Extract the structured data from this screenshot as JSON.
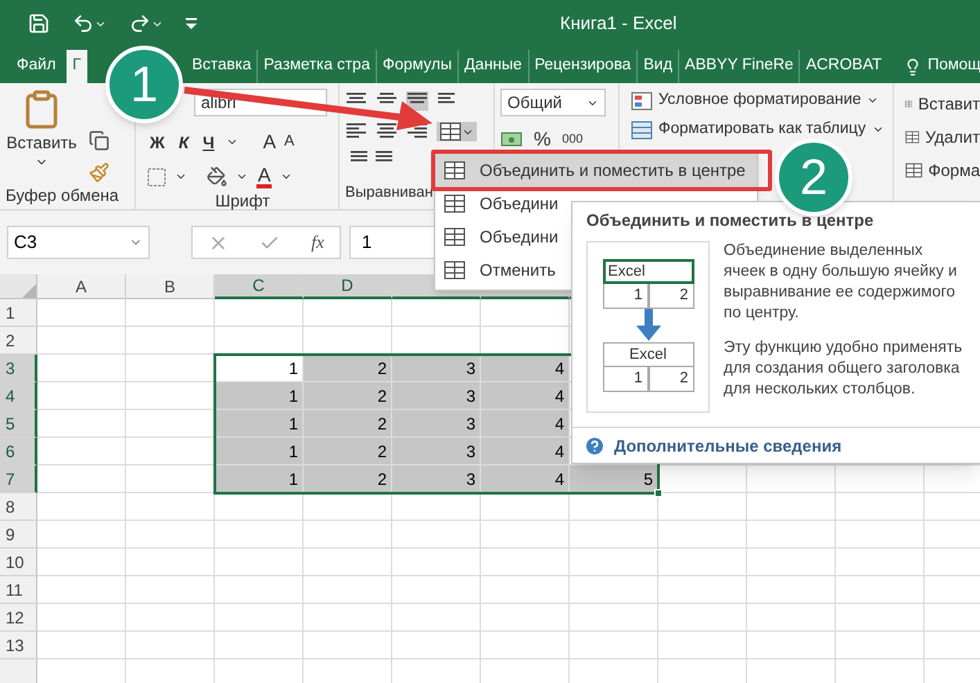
{
  "window": {
    "title": "Книга1 - Excel"
  },
  "ribbon_tabs": [
    {
      "label": "Файл",
      "selected": false
    },
    {
      "label": "Г",
      "selected": true
    },
    {
      "label": "Вставка",
      "selected": false
    },
    {
      "label": "Разметка стра",
      "selected": false
    },
    {
      "label": "Формулы",
      "selected": false
    },
    {
      "label": "Данные",
      "selected": false
    },
    {
      "label": "Рецензирова",
      "selected": false
    },
    {
      "label": "Вид",
      "selected": false
    },
    {
      "label": "ABBYY FineRe",
      "selected": false
    },
    {
      "label": "ACROBAT",
      "selected": false
    },
    {
      "label": "Помощ",
      "selected": false,
      "kind": "help"
    }
  ],
  "ribbon": {
    "clipboard": {
      "paste": "Вставить",
      "group_label": "Буфер обмена"
    },
    "font": {
      "font_name": "alibri",
      "bold": "Ж",
      "italic": "К",
      "underline": "Ч",
      "grow": "A",
      "shrink": "A",
      "font_color_button": "A",
      "group_label": "Шрифт"
    },
    "alignment": {
      "group_label": "Выравниван"
    },
    "number": {
      "format": "Общий",
      "percent": "%",
      "thousands": "000"
    },
    "styles": {
      "conditional": "Условное форматирование",
      "as_table": "Форматировать как таблицу"
    },
    "cells": {
      "insert": "Вставит",
      "delete": "Удалит",
      "format": "Форма"
    }
  },
  "formula_bar": {
    "name_box": "C3",
    "function_label": "fx",
    "value": "1"
  },
  "sheet": {
    "columns": [
      {
        "label": "A"
      },
      {
        "label": "B"
      },
      {
        "label": "C"
      },
      {
        "label": "D"
      }
    ],
    "rows": [
      {
        "label": "1",
        "cells": []
      },
      {
        "label": "2",
        "cells": []
      },
      {
        "label": "3",
        "cells": [
          {
            "value": "1",
            "selected": true,
            "active": true
          },
          {
            "value": "2",
            "selected": true,
            "active": false
          },
          {
            "value": "3",
            "selected": true,
            "active": false
          },
          {
            "value": "4",
            "selected": true,
            "active": false
          }
        ]
      },
      {
        "label": "4",
        "cells": [
          {
            "value": "1",
            "selected": true,
            "active": false
          },
          {
            "value": "2",
            "selected": true,
            "active": false
          },
          {
            "value": "3",
            "selected": true,
            "active": false
          },
          {
            "value": "4",
            "selected": true,
            "active": false
          }
        ]
      },
      {
        "label": "5",
        "cells": [
          {
            "value": "1",
            "selected": true,
            "active": false
          },
          {
            "value": "2",
            "selected": true,
            "active": false
          },
          {
            "value": "3",
            "selected": true,
            "active": false
          },
          {
            "value": "4",
            "selected": true,
            "active": false
          }
        ]
      },
      {
        "label": "6",
        "cells": [
          {
            "value": "1",
            "selected": true,
            "active": false
          },
          {
            "value": "2",
            "selected": true,
            "active": false
          },
          {
            "value": "3",
            "selected": true,
            "active": false
          },
          {
            "value": "4",
            "selected": true,
            "active": false
          }
        ]
      },
      {
        "label": "7",
        "cells": [
          {
            "value": "1",
            "selected": true,
            "active": false
          },
          {
            "value": "2",
            "selected": true,
            "active": false
          },
          {
            "value": "3",
            "selected": true,
            "active": false
          },
          {
            "value": "4",
            "selected": true,
            "active": false
          },
          {
            "value": "5",
            "selected": true,
            "active": false
          }
        ]
      },
      {
        "label": "8",
        "cells": []
      },
      {
        "label": "9",
        "cells": []
      },
      {
        "label": "10",
        "cells": []
      },
      {
        "label": "11",
        "cells": []
      },
      {
        "label": "12",
        "cells": []
      },
      {
        "label": "13",
        "cells": []
      }
    ]
  },
  "merge_menu": {
    "items": [
      {
        "label": "Объединить и поместить в центре",
        "selected": true
      },
      {
        "label": "Объедини",
        "selected": false
      },
      {
        "label": "Объедини",
        "selected": false
      },
      {
        "label": "Отменить",
        "selected": false
      }
    ]
  },
  "tooltip": {
    "title": "Объединить и поместить в центре",
    "example": {
      "before": {
        "header": "Excel",
        "cells": [
          "1",
          "2"
        ]
      },
      "after": {
        "header": "Excel",
        "cells": [
          "1",
          "2"
        ]
      }
    },
    "body": [
      "Объединение выделенных ячеек в одну большую ячейку и выравнивание ее содержимого по центру.",
      "Эту функцию удобно применять для создания общего заголовка для нескольких столбцов."
    ],
    "link": "Дополнительные сведения"
  },
  "callouts": [
    {
      "number": "1"
    },
    {
      "number": "2"
    }
  ]
}
